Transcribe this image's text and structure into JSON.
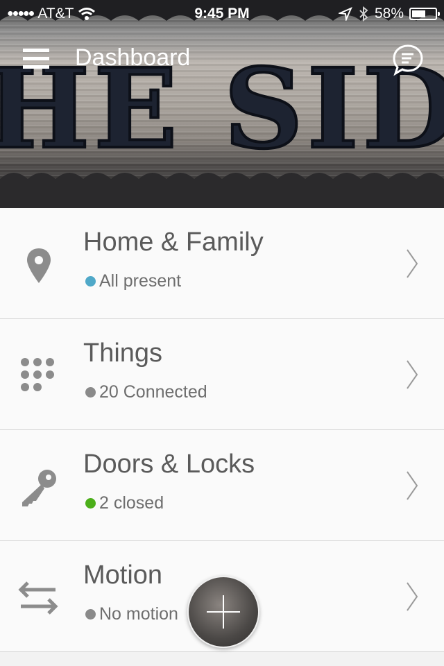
{
  "status_bar": {
    "signal": "●●●●●",
    "carrier": "AT&T",
    "time": "9:45 PM",
    "battery_percent": "58%",
    "battery_level": 0.58
  },
  "header": {
    "title": "Dashboard",
    "menu_icon": "hamburger-menu-icon",
    "chat_icon": "chat-bubble-icon",
    "background_sign_text": "HE SIDDIQ"
  },
  "rows": [
    {
      "title": "Home & Family",
      "status": "All present",
      "dot_color": "#4fa8c8",
      "icon": "location-pin-icon"
    },
    {
      "title": "Things",
      "status": "20 Connected",
      "dot_color": "#8a8a8a",
      "icon": "dots-grid-icon"
    },
    {
      "title": "Doors & Locks",
      "status": "2 closed",
      "dot_color": "#4caf1a",
      "icon": "key-icon"
    },
    {
      "title": "Motion",
      "status": "No motion",
      "dot_color": "#8a8a8a",
      "icon": "arrows-swap-icon"
    }
  ],
  "fab": {
    "icon": "plus-icon"
  }
}
